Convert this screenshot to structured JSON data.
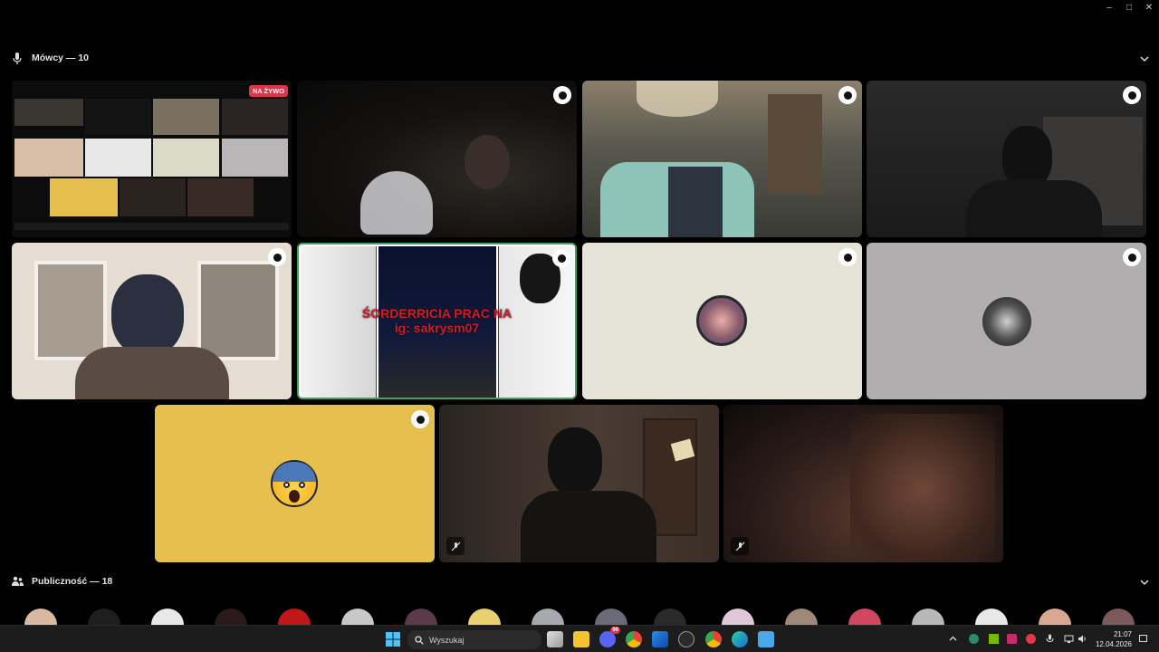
{
  "window": {
    "minimize": "–",
    "maximize": "□",
    "close": "✕"
  },
  "speakers": {
    "label": "Mówcy — 10"
  },
  "audience": {
    "label": "Publiczność — 18"
  },
  "stream": {
    "live_label": "NA ŻYWO"
  },
  "tiles": {
    "anime_overlay_line1": "ŚORDERRICIA PRAC NA",
    "anime_overlay_line2": "ig: sakrysm07"
  },
  "taskbar": {
    "search_placeholder": "Wyszukaj",
    "time": "21:07",
    "date": "12.04.2026",
    "discord_badge": "99"
  },
  "colors": {
    "background": "#000000",
    "live_red": "#e0344a",
    "active_border": "#3ba55d",
    "yellow_tile": "#e6bf4f",
    "beige_tile": "#e6e4d6",
    "grey_tile": "#b1aeb0"
  }
}
